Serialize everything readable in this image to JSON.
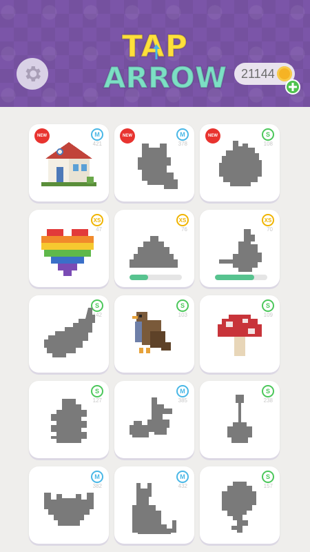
{
  "header": {
    "logo_line1": "TAP",
    "logo_line2": "ARROW",
    "coins": "21144"
  },
  "colors": {
    "header_bg": "#7b55a8",
    "logo_yellow": "#ffe03a",
    "logo_teal": "#7ce0c4",
    "size_s": "#4bc75a",
    "size_m": "#49b7e6",
    "size_xs": "#f0b400",
    "new_red": "#e8332f",
    "silhouette": "#7a7a7a",
    "progress": "#57c38f"
  },
  "puzzles": [
    {
      "name": "house",
      "size": "M",
      "count": "421",
      "new": true,
      "solved": true
    },
    {
      "name": "raccoon",
      "size": "M",
      "count": "378",
      "new": true,
      "solved": false
    },
    {
      "name": "apple",
      "size": "S",
      "count": "108",
      "new": true,
      "solved": false
    },
    {
      "name": "heart",
      "size": "XS",
      "count": "47",
      "new": false,
      "solved": true
    },
    {
      "name": "pile",
      "size": "XS",
      "count": "76",
      "new": false,
      "solved": false,
      "progress": 0.35
    },
    {
      "name": "bird",
      "size": "XS",
      "count": "70",
      "new": false,
      "solved": false,
      "progress": 0.75
    },
    {
      "name": "eggplant",
      "size": "S",
      "count": "142",
      "new": false,
      "solved": false
    },
    {
      "name": "hawk",
      "size": "S",
      "count": "103",
      "new": false,
      "solved": true
    },
    {
      "name": "mushroom",
      "size": "S",
      "count": "109",
      "new": false,
      "solved": true
    },
    {
      "name": "beetle",
      "size": "S",
      "count": "127",
      "new": false,
      "solved": false
    },
    {
      "name": "cherries",
      "size": "M",
      "count": "385",
      "new": false,
      "solved": false
    },
    {
      "name": "banjo",
      "size": "S",
      "count": "238",
      "new": false,
      "solved": false
    },
    {
      "name": "bat",
      "size": "M",
      "count": "382",
      "new": false,
      "solved": false
    },
    {
      "name": "cat",
      "size": "M",
      "count": "432",
      "new": false,
      "solved": false
    },
    {
      "name": "flower",
      "size": "S",
      "count": "157",
      "new": false,
      "solved": false
    }
  ],
  "labels": {
    "new": "NEW"
  }
}
